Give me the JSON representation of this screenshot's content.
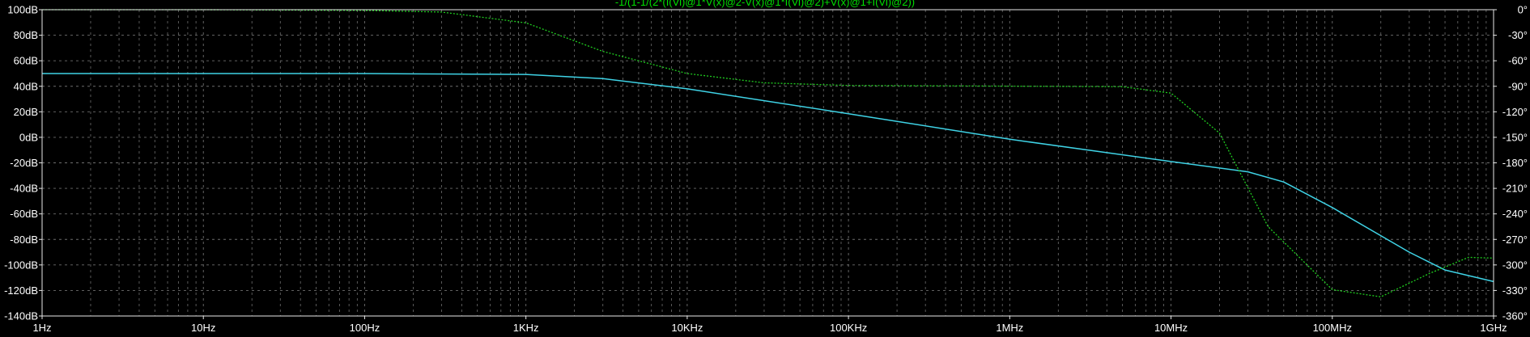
{
  "chart_data": {
    "type": "line",
    "title": "-1/(1-1/(2*(I(Vi)@1*V(x)@2-V(x)@1*I(Vi)@2)+V(x)@1+I(Vi)@2))",
    "x_scale": "log",
    "xlim": [
      1,
      1000000000
    ],
    "x_ticks": [
      "1Hz",
      "10Hz",
      "100Hz",
      "1KHz",
      "10KHz",
      "100KHz",
      "1MHz",
      "10MHz",
      "100MHz",
      "1GHz"
    ],
    "y_left_label_ticks": [
      "100dB",
      "80dB",
      "60dB",
      "40dB",
      "20dB",
      "0dB",
      "-20dB",
      "-40dB",
      "-60dB",
      "-80dB",
      "-100dB",
      "-120dB",
      "-140dB"
    ],
    "ylim_left": [
      -140,
      100
    ],
    "y_right_label_ticks": [
      "0°",
      "-30°",
      "-60°",
      "-90°",
      "-120°",
      "-150°",
      "-180°",
      "-210°",
      "-240°",
      "-270°",
      "-300°",
      "-330°",
      "-360°"
    ],
    "ylim_right": [
      -360,
      0
    ],
    "grid": true,
    "colors": {
      "background": "#000000",
      "grid": "#6e6e6e",
      "frame": "#e8e8e8",
      "text": "#ffffff",
      "title": "#00e000",
      "magnitude": "#3fd3e6",
      "phase": "#1fcc1f"
    },
    "series": [
      {
        "role": "magnitude",
        "axis": "left",
        "line": "solid",
        "x": [
          1,
          100,
          1000,
          3000,
          10000,
          100000,
          1000000,
          10000000,
          30000000,
          50000000,
          100000000,
          300000000,
          500000000,
          1000000000
        ],
        "y": [
          50,
          50,
          49.3,
          46,
          38,
          18.5,
          -1.5,
          -19,
          -27,
          -35,
          -55,
          -90,
          -104,
          -113
        ]
      },
      {
        "role": "phase",
        "axis": "right",
        "line": "dotted",
        "x": [
          1,
          10,
          100,
          300,
          1000,
          3000,
          10000,
          30000,
          100000,
          1000000,
          5000000,
          10000000,
          20000000,
          40000000,
          100000000,
          200000000,
          400000000,
          700000000,
          1000000000
        ],
        "y": [
          0,
          0,
          -0.9,
          -2.8,
          -15.5,
          -49,
          -75,
          -86,
          -89,
          -89.9,
          -90.5,
          -98,
          -145,
          -255,
          -329,
          -337.5,
          -310,
          -291,
          -292
        ]
      }
    ]
  }
}
